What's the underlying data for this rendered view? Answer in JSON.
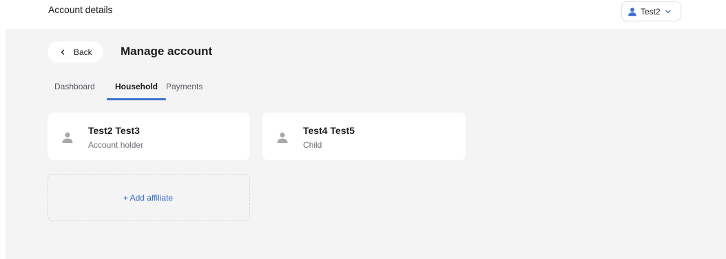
{
  "header": {
    "title": "Account details",
    "user_menu": {
      "username": "Test2",
      "icon": "user-icon",
      "chevron": "chevron-down-icon"
    }
  },
  "page": {
    "back_label": "Back",
    "title": "Manage account"
  },
  "tabs": [
    {
      "label": "Dashboard",
      "active": false
    },
    {
      "label": "Household",
      "active": true
    },
    {
      "label": "Payments",
      "active": false
    }
  ],
  "members": [
    {
      "name": "Test2 Test3",
      "role": "Account holder",
      "icon": "person-icon"
    },
    {
      "name": "Test4 Test5",
      "role": "Child",
      "icon": "person-icon"
    }
  ],
  "add_affiliate_label": "+ Add affiliate",
  "colors": {
    "accent": "#3b6fd6",
    "link": "#2f67d6",
    "background": "#f4f4f4",
    "card": "#ffffff"
  }
}
